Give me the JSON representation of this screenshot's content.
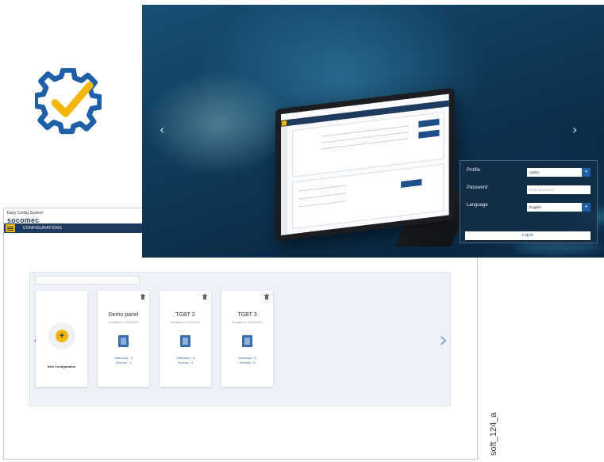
{
  "logo": {
    "icon": "gear-check-icon",
    "colors": {
      "blue": "#1f5fa8",
      "yellow": "#f2b705"
    }
  },
  "config_app": {
    "window_title": "Easy Config System",
    "brand": "socomec",
    "nav_label": "CONFIGURATIONS",
    "search_placeholder": "",
    "cards": [
      {
        "title": "Demo panel",
        "modified": "Modified on 2020/03/24",
        "gateways": "Gateways : 5",
        "devices": "Devices : 1"
      },
      {
        "title": "TGBT 2",
        "modified": "Modified on 2020/03/24",
        "gateways": "Gateways : 6",
        "devices": "Devices : 0"
      },
      {
        "title": "TGBT 3",
        "modified": "Modified on 2020/03/24",
        "gateways": "Gateways : 6",
        "devices": "Devices : 0"
      }
    ],
    "new_config_label": "New Configuration"
  },
  "login": {
    "profile_label": "Profile",
    "profile_value": "Admin",
    "password_label": "Password",
    "password_placeholder": "Enter password",
    "language_label": "Language",
    "language_value": "English",
    "login_button": "Log in"
  },
  "image_code": "soft_124_a",
  "colors": {
    "navy": "#1f3a5f",
    "accent": "#f2b705",
    "link": "#3a6cb0"
  }
}
